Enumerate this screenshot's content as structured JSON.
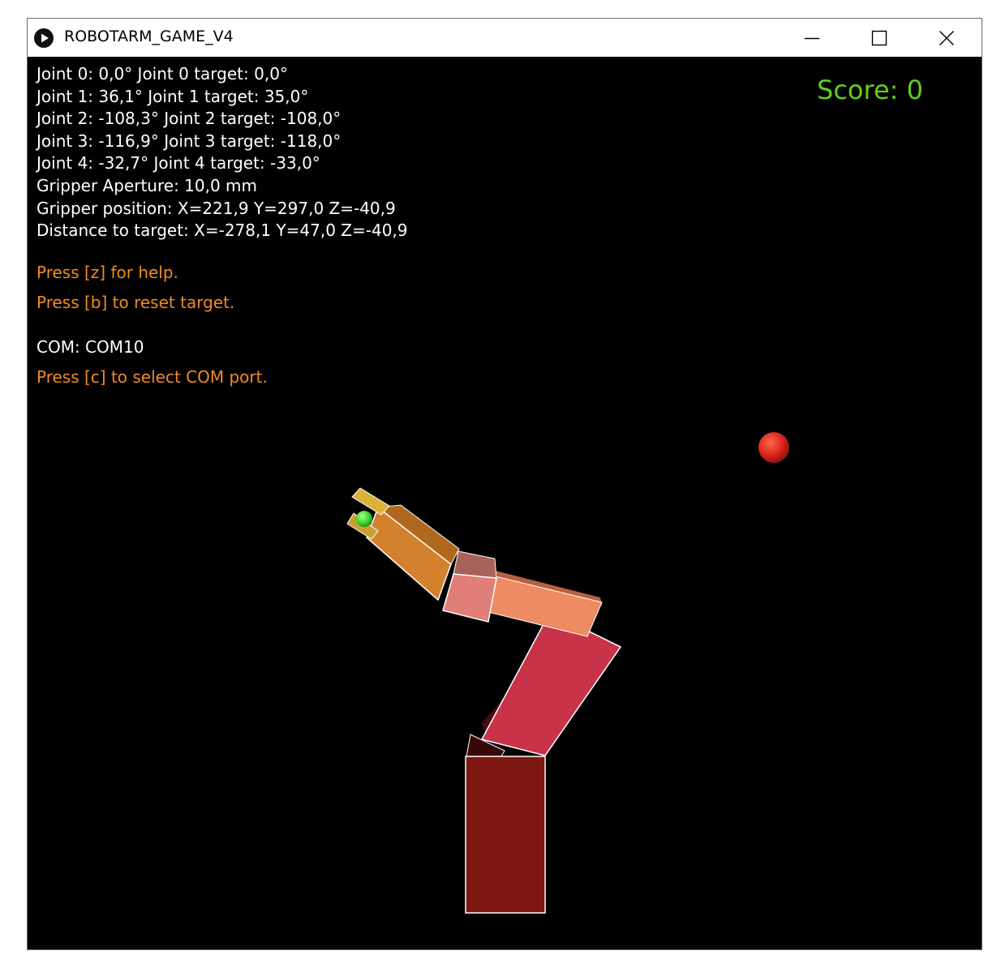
{
  "window": {
    "title": "ROBOTARM_GAME_V4",
    "minimize_icon": "minimize-icon",
    "maximize_icon": "maximize-icon",
    "close_icon": "close-icon",
    "app_icon": "play-icon"
  },
  "status": {
    "lines": [
      "Joint 0: 0,0° Joint 0 target: 0,0°",
      "Joint 1: 36,1° Joint 1 target: 35,0°",
      "Joint 2: -108,3° Joint 2 target: -108,0°",
      "Joint 3: -116,9° Joint 3 target: -118,0°",
      "Joint 4: -32,7° Joint 4 target: -33,0°",
      "Gripper Aperture: 10,0 mm",
      "Gripper position: X=221,9 Y=297,0 Z=-40,9",
      "Distance to target: X=-278,1 Y=47,0 Z=-40,9"
    ],
    "help_hint": "Press [z] for help.",
    "reset_hint": "Press [b] to reset target.",
    "com_label": "COM: COM10",
    "com_hint": "Press [c] to select COM port."
  },
  "score": {
    "label": "Score: 0"
  },
  "colors": {
    "background": "#000000",
    "info_text": "#ffffff",
    "hint_text": "#f08a24",
    "score_text": "#5fce1c",
    "target_ball": "#e0271a",
    "gripper_ball": "#49e03a",
    "base": "#7f1810",
    "lower_arm": "#c9334a",
    "upper_arm": "#ee8b63",
    "wrist": "#e07f78",
    "forearm": "#d4812e",
    "gripper": "#d9b23a"
  }
}
